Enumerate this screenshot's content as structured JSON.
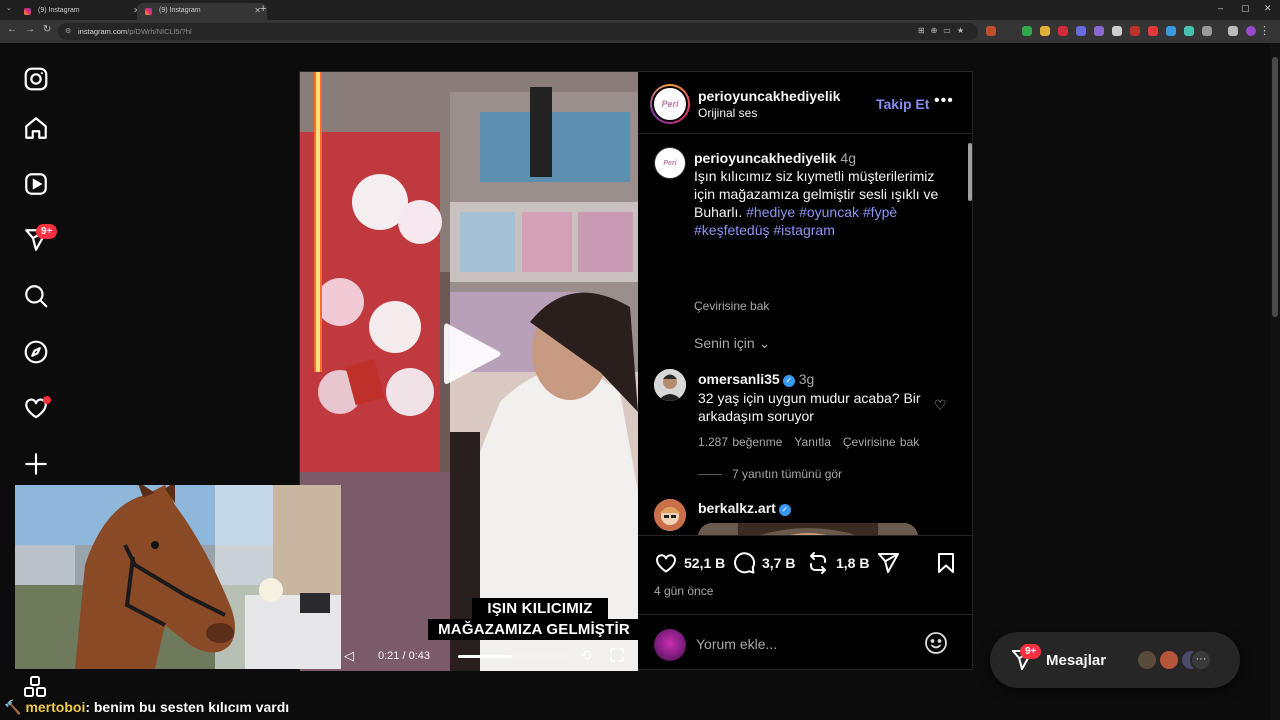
{
  "browser": {
    "tabs": [
      {
        "title": "(9) Instagram",
        "active": false
      },
      {
        "title": "(9) Instagram",
        "active": true
      }
    ],
    "url_host": "instagram.com",
    "url_path": "/p/DWrh/NICLl5/?hl"
  },
  "sidebar": {
    "icons": [
      "instagram-logo-icon",
      "home-icon",
      "reels-icon",
      "direct-messages-icon",
      "search-icon",
      "explore-icon",
      "notifications-icon",
      "create-icon"
    ],
    "messages_badge": "9+"
  },
  "post": {
    "video": {
      "subtitle_line1": "IŞIN KILICIMIZ",
      "subtitle_line2": "MAĞAZAMIZA GELMİŞTİR",
      "time": "0:21 / 0:43",
      "progress_fraction": 0.49
    },
    "header": {
      "username": "perioyuncakhediyelik",
      "audio": "Orijinal ses",
      "follow": "Takip Et",
      "more": "•••",
      "avatar_text": "Peri"
    },
    "caption": {
      "username": "perioyuncakhediyelik",
      "time": "4g",
      "text": "Işın kılıcımız siz kıymetli müşterilerimiz için mağazamıza gelmiştir sesli ışıklı ve Buharlı.",
      "hashtags": "#hediye #oyuncak #fypè #keşfetedüş #istagram",
      "translate": "Çevirisine bak"
    },
    "for_you": "Senin için",
    "comments": [
      {
        "username": "omersanli35",
        "time": "3g",
        "text": "32 yaş için uygun mudur acaba? Bir arkadaşım soruyor",
        "likes": "1.287 beğenme",
        "reply": "Yanıtla",
        "translate": "Çevirisine bak",
        "view_replies": "7 yanıtın tümünü gör"
      },
      {
        "username": "berkalkz.art"
      }
    ],
    "actions": {
      "likes": "52,1 B",
      "comments": "3,7 B",
      "reposts": "1,8 B",
      "posted": "4 gün önce"
    },
    "comment_input_placeholder": "Yorum ekle..."
  },
  "messages": {
    "label": "Mesajlar",
    "badge": "9+",
    "more": "···"
  },
  "chat_overlay": {
    "nick": "mertoboi",
    "message": ": benim bu sesten kılıcım vardı"
  },
  "colors": {
    "accent_link": "#858cf2",
    "hashtag": "#8f95f5",
    "badge": "#ff3040",
    "verified": "#3897f0"
  }
}
